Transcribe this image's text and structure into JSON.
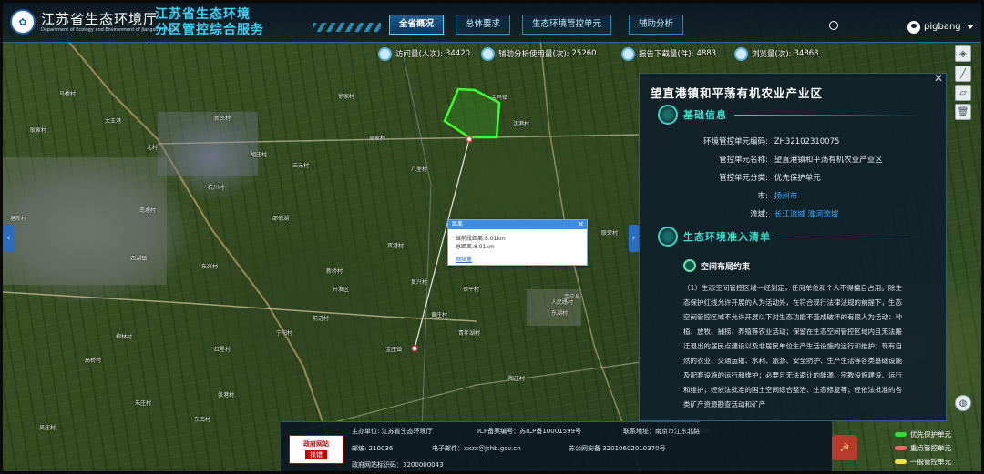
{
  "header": {
    "dept_cn": "江苏省生态环境厅",
    "dept_en": "Department of Ecology and Environment of Jiangsu Province",
    "service_title_line1": "江苏省生态环境",
    "service_title_line2": "分区管控综合服务",
    "nav": [
      {
        "label": "全省概况",
        "active": true
      },
      {
        "label": "总体要求",
        "active": false
      },
      {
        "label": "生态环境管控单元",
        "active": false
      },
      {
        "label": "辅助分析",
        "active": false
      }
    ],
    "username": "pigbang"
  },
  "stats": [
    {
      "icon": "user-icon",
      "label": "访问量(人次):",
      "value": "34420"
    },
    {
      "icon": "analysis-icon",
      "label": "辅助分析使用量(次):",
      "value": "25260"
    },
    {
      "icon": "download-icon",
      "label": "报告下载量(件):",
      "value": "4883"
    },
    {
      "icon": "eye-icon",
      "label": "浏览量(次):",
      "value": "34868"
    }
  ],
  "map": {
    "labels": [
      "马桥村",
      "耿家村",
      "大王港",
      "新民村",
      "徐家村",
      "金马镇",
      "周家村",
      "沈港村",
      "胡庄村",
      "三元村",
      "北村",
      "杭川村",
      "南塘村",
      "塘新村",
      "八里村",
      "邵伯湖",
      "宝应县",
      "双港村",
      "联荣村",
      "保平村",
      "复兴村",
      "东湖村",
      "新桥村",
      "开发区",
      "黄庄村",
      "青年湖村",
      "宝庄镇",
      "人民路村",
      "宁阳村",
      "西湖镇",
      "东兴村",
      "前进村",
      "柳林村",
      "红星村",
      "张港村",
      "东南村",
      "朱庄村",
      "高桥村",
      "吴庄村",
      "陶庄村"
    ],
    "measure_popup": {
      "title": "距离",
      "segment": "当前段距离:8.01km",
      "total": "总距离:8.01km",
      "link": "继续量"
    }
  },
  "panel": {
    "title": "望直港镇和平荡有机农业产业区",
    "basic_info_title": "基础信息",
    "rows": [
      {
        "key": "环境管控单元编码:",
        "value": "ZH32102310075"
      },
      {
        "key": "管控单元名称:",
        "value": "望直港镇和平荡有机农业产业区"
      },
      {
        "key": "管控单元分类:",
        "value": "优先保护单元"
      },
      {
        "key": "市:",
        "value": "扬州市"
      },
      {
        "key": "流域:",
        "value": "长江流域 淮河流域"
      }
    ],
    "access_list_title": "生态环境准入清单",
    "spatial_title": "空间布局约束",
    "spatial_text": "（1）生态空间管控区域一经划定，任何单位和个人不得擅自占用。除生态保护红线允许开展的人为活动外，在符合现行法律法规的前提下，生态空间管控区域不允许开展以下对生态功能不造成破坏的有限人为活动：种植、放牧、捕捞、养殖等农业活动；保留在生态空间管控区域内且无法搬迁退出的居民点建设以及非居民单位生产生活设施的运行和维护；现有自然的农业、交通运输、水利、旅游、安全防护、生产生活等各类基础设施及配套设施的运行和维护；必要且无法避让的能源、宗教设施建设、运行和维护；经依法批准的国土空间综合整治、生态修复等；经依法批准的各类矿产资源勘查活动和矿产"
  },
  "footer": {
    "logo_top": "政府网站",
    "logo_bottom": "找错",
    "host": "主办单位:  江苏省生态环境厅",
    "icp": "ICP备案编号：苏ICP备10001599号",
    "contact": "联系地址：南京市江东北路8号",
    "postcode": "邮编:  210036",
    "email": "电子邮件：xxzx＠jshb.gov.cn",
    "police": "苏公网安备 32010602010370号",
    "site_id": "政府网站标识码：3200000043"
  },
  "legend": [
    {
      "label": "优先保护单元",
      "color": "#2fdc3a"
    },
    {
      "label": "重点管控单元",
      "color": "#f06a6a"
    },
    {
      "label": "一般管控单元",
      "color": "#f0e24a"
    }
  ],
  "colors": {
    "accent": "#33d6ff",
    "panel_accent": "#35e0cf",
    "link": "#3fa7ff"
  }
}
